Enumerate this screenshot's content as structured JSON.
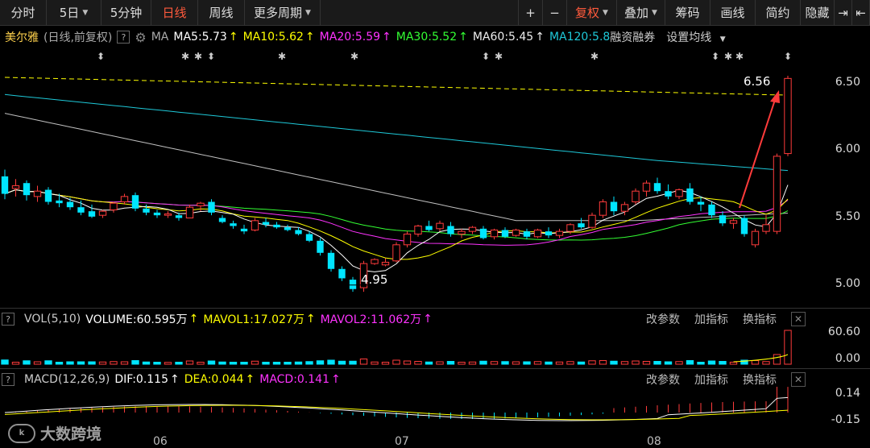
{
  "toolbar": {
    "tabs": [
      {
        "label": "分时",
        "width": 58
      },
      {
        "label": "5日",
        "width": 68,
        "caret": true
      },
      {
        "label": "5分钟",
        "width": 62
      },
      {
        "label": "日线",
        "width": 58,
        "active": true
      },
      {
        "label": "周线",
        "width": 58
      },
      {
        "label": "更多周期",
        "width": 94,
        "caret": true
      }
    ],
    "right": [
      {
        "label": "+",
        "width": 30
      },
      {
        "label": "−",
        "width": 30
      },
      {
        "label": "复权",
        "width": 62,
        "caret": true,
        "active": true
      },
      {
        "label": "叠加",
        "width": 60,
        "caret": true
      },
      {
        "label": "筹码",
        "width": 56
      },
      {
        "label": "画线",
        "width": 56
      },
      {
        "label": "简约",
        "width": 56
      },
      {
        "label": "隐藏",
        "width": 42
      },
      {
        "label": "⇥",
        "width": 22
      },
      {
        "label": "⇤",
        "width": 22
      }
    ]
  },
  "info": {
    "name": "美尔雅",
    "mode": "(日线,前复权)",
    "ma": "MA",
    "ma5": "MA5:5.73",
    "ma10": "MA10:5.62",
    "ma20": "MA20:5.59",
    "ma30": "MA30:5.52",
    "ma60": "MA60:5.45",
    "ma120": "MA120:5.8",
    "margin": "融资融券",
    "settings": "设置均线"
  },
  "colors": {
    "up": "#ff3b3b",
    "down": "#00e5ff",
    "ma5": "#ffffff",
    "ma10": "#ffff00",
    "ma20": "#ff33ff",
    "ma30": "#33ff33",
    "ma60": "#c0c0c0",
    "ma120": "#1ec8d8"
  },
  "axis": {
    "price": [
      "6.50",
      "6.00",
      "5.50",
      "5.00"
    ],
    "vol": [
      "60.60",
      "0.00"
    ],
    "macd": [
      "0.14",
      "-0.15"
    ]
  },
  "annotations": {
    "high": "6.56",
    "low": "4.95"
  },
  "vol_panel": {
    "title": "VOL(5,10)",
    "volume": "VOLUME:60.595万",
    "mavol1": "MAVOL1:17.027万",
    "mavol2": "MAVOL2:11.062万",
    "btn_param": "改参数",
    "btn_add": "加指标",
    "btn_swap": "换指标"
  },
  "macd_panel": {
    "title": "MACD(12,26,9)",
    "dif": "DIF:0.115",
    "dea": "DEA:0.044",
    "macd": "MACD:0.141",
    "btn_param": "改参数",
    "btn_add": "加指标",
    "btn_swap": "换指标"
  },
  "dates": [
    "06",
    "07",
    "08"
  ],
  "watermark": "大数跨境",
  "candles": [
    [
      5.81,
      5.86,
      5.64,
      5.68
    ],
    [
      5.72,
      5.79,
      5.66,
      5.74
    ],
    [
      5.76,
      5.78,
      5.63,
      5.67
    ],
    [
      5.66,
      5.74,
      5.62,
      5.7
    ],
    [
      5.71,
      5.73,
      5.6,
      5.62
    ],
    [
      5.63,
      5.68,
      5.58,
      5.61
    ],
    [
      5.62,
      5.65,
      5.56,
      5.58
    ],
    [
      5.58,
      5.63,
      5.52,
      5.54
    ],
    [
      5.55,
      5.6,
      5.5,
      5.51
    ],
    [
      5.52,
      5.56,
      5.5,
      5.55
    ],
    [
      5.56,
      5.62,
      5.54,
      5.61
    ],
    [
      5.62,
      5.68,
      5.6,
      5.66
    ],
    [
      5.67,
      5.69,
      5.55,
      5.57
    ],
    [
      5.57,
      5.6,
      5.52,
      5.54
    ],
    [
      5.54,
      5.56,
      5.5,
      5.52
    ],
    [
      5.52,
      5.55,
      5.5,
      5.53
    ],
    [
      5.52,
      5.54,
      5.48,
      5.5
    ],
    [
      5.5,
      5.6,
      5.5,
      5.58
    ],
    [
      5.59,
      5.62,
      5.55,
      5.61
    ],
    [
      5.62,
      5.64,
      5.52,
      5.54
    ],
    [
      5.5,
      5.52,
      5.46,
      5.47
    ],
    [
      5.46,
      5.48,
      5.42,
      5.44
    ],
    [
      5.42,
      5.45,
      5.38,
      5.4
    ],
    [
      5.41,
      5.5,
      5.4,
      5.48
    ],
    [
      5.47,
      5.5,
      5.43,
      5.45
    ],
    [
      5.45,
      5.47,
      5.42,
      5.43
    ],
    [
      5.43,
      5.45,
      5.4,
      5.41
    ],
    [
      5.41,
      5.43,
      5.37,
      5.38
    ],
    [
      5.38,
      5.4,
      5.32,
      5.33
    ],
    [
      5.33,
      5.35,
      5.22,
      5.24
    ],
    [
      5.24,
      5.26,
      5.1,
      5.12
    ],
    [
      5.12,
      5.14,
      5.03,
      5.05
    ],
    [
      5.04,
      5.06,
      4.95,
      4.97
    ],
    [
      4.98,
      5.18,
      4.95,
      5.16
    ],
    [
      5.16,
      5.2,
      5.15,
      5.19
    ],
    [
      5.15,
      5.2,
      5.14,
      5.17
    ],
    [
      5.18,
      5.32,
      5.17,
      5.3
    ],
    [
      5.3,
      5.4,
      5.28,
      5.38
    ],
    [
      5.38,
      5.45,
      5.36,
      5.44
    ],
    [
      5.44,
      5.48,
      5.4,
      5.41
    ],
    [
      5.42,
      5.48,
      5.4,
      5.46
    ],
    [
      5.44,
      5.47,
      5.36,
      5.38
    ],
    [
      5.38,
      5.42,
      5.35,
      5.4
    ],
    [
      5.4,
      5.44,
      5.38,
      5.43
    ],
    [
      5.42,
      5.44,
      5.34,
      5.35
    ],
    [
      5.36,
      5.42,
      5.34,
      5.41
    ],
    [
      5.41,
      5.43,
      5.35,
      5.36
    ],
    [
      5.37,
      5.42,
      5.36,
      5.41
    ],
    [
      5.4,
      5.42,
      5.34,
      5.36
    ],
    [
      5.36,
      5.42,
      5.35,
      5.41
    ],
    [
      5.4,
      5.43,
      5.35,
      5.37
    ],
    [
      5.37,
      5.42,
      5.35,
      5.4
    ],
    [
      5.4,
      5.46,
      5.38,
      5.45
    ],
    [
      5.46,
      5.5,
      5.42,
      5.43
    ],
    [
      5.43,
      5.54,
      5.42,
      5.52
    ],
    [
      5.52,
      5.64,
      5.5,
      5.62
    ],
    [
      5.62,
      5.66,
      5.52,
      5.55
    ],
    [
      5.55,
      5.62,
      5.52,
      5.6
    ],
    [
      5.62,
      5.72,
      5.6,
      5.7
    ],
    [
      5.7,
      5.78,
      5.66,
      5.76
    ],
    [
      5.76,
      5.8,
      5.68,
      5.7
    ],
    [
      5.7,
      5.75,
      5.64,
      5.66
    ],
    [
      5.66,
      5.72,
      5.64,
      5.71
    ],
    [
      5.72,
      5.76,
      5.6,
      5.62
    ],
    [
      5.62,
      5.66,
      5.55,
      5.6
    ],
    [
      5.6,
      5.62,
      5.5,
      5.52
    ],
    [
      5.52,
      5.55,
      5.44,
      5.46
    ],
    [
      5.46,
      5.5,
      5.42,
      5.48
    ],
    [
      5.5,
      5.52,
      5.36,
      5.38
    ],
    [
      5.3,
      5.42,
      5.28,
      5.4
    ],
    [
      5.4,
      5.52,
      5.38,
      5.45
    ],
    [
      5.4,
      5.98,
      5.38,
      5.96
    ],
    [
      5.98,
      6.56,
      5.96,
      6.54
    ]
  ]
}
